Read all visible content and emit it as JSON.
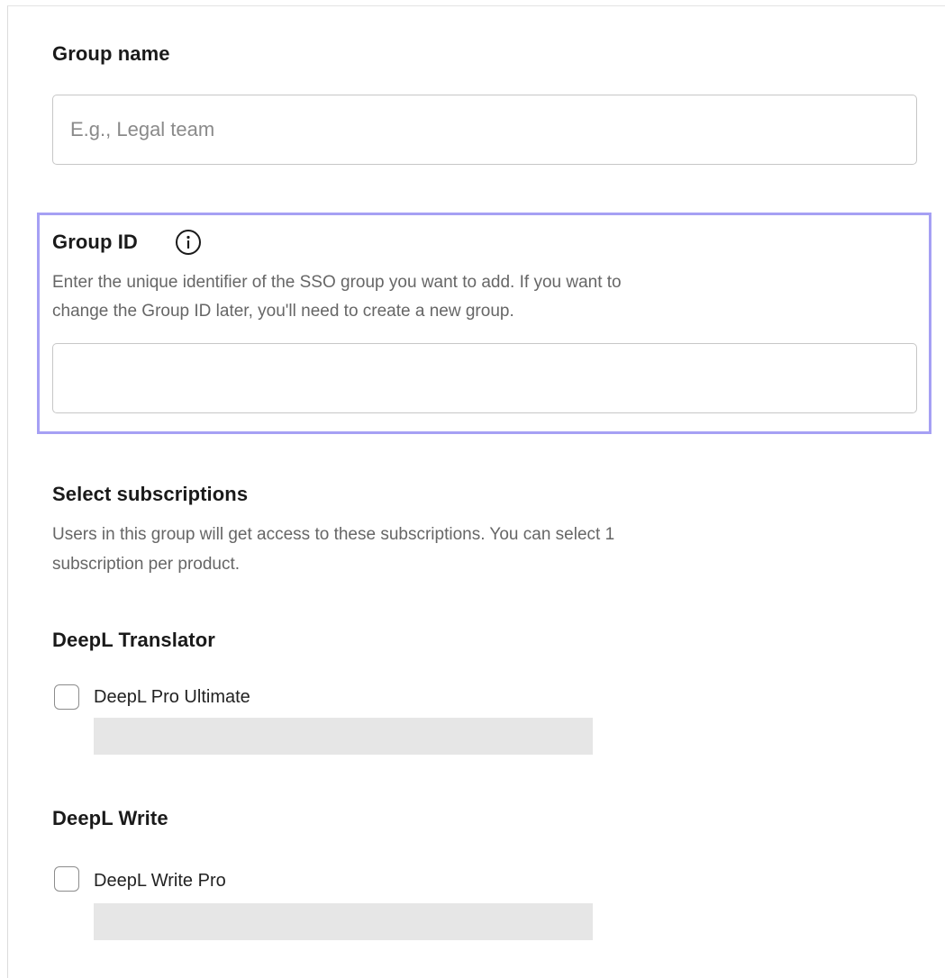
{
  "group_name": {
    "label": "Group name",
    "placeholder": "E.g., Legal team",
    "value": ""
  },
  "group_id": {
    "label": "Group ID",
    "info_icon": "info-circle-icon",
    "description_line1": "Enter the unique identifier of the SSO group you want to add. If you want to",
    "description_line2": "change the Group ID later, you'll need to create a new group.",
    "value": "",
    "focus_color": "#a6a0f4"
  },
  "subscriptions": {
    "title": "Select subscriptions",
    "description_line1": "Users in this group will get access to these subscriptions. You can select 1",
    "description_line2": "subscription per product.",
    "products": [
      {
        "name": "DeepL Translator",
        "options": [
          {
            "label": "DeepL Pro Ultimate",
            "checked": false
          }
        ]
      },
      {
        "name": "DeepL Write",
        "options": [
          {
            "label": "DeepL Write Pro",
            "checked": false
          }
        ]
      }
    ]
  }
}
